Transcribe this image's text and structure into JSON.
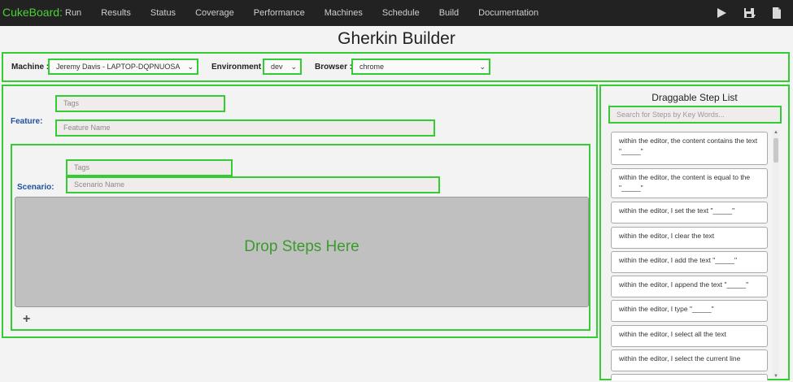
{
  "navbar": {
    "brand": "CukeBoard:",
    "items": [
      "Run",
      "Results",
      "Status",
      "Coverage",
      "Performance",
      "Machines",
      "Schedule",
      "Build",
      "Documentation"
    ],
    "icons": [
      "play-icon",
      "save-icon",
      "file-icon"
    ]
  },
  "page": {
    "title": "Gherkin Builder"
  },
  "config": {
    "machine_label": "Machine :",
    "machine_value": "Jeremy Davis - LAPTOP-DQPNUOSA",
    "environment_label": "Environment :",
    "environment_value": "dev",
    "browser_label": "Browser :",
    "browser_value": "chrome"
  },
  "feature": {
    "label": "Feature:",
    "tags_placeholder": "Tags",
    "name_placeholder": "Feature Name"
  },
  "scenario": {
    "label": "Scenario:",
    "tags_placeholder": "Tags",
    "name_placeholder": "Scenario Name",
    "drop_text": "Drop Steps Here",
    "add_label": "+"
  },
  "step_list": {
    "title": "Draggable Step List",
    "search_placeholder": "Search for Steps by Key Words...",
    "steps": [
      "within the editor, the content contains the text \"_____\"",
      "within the editor, the content is equal to the \"_____\"",
      "within the editor, I set the text \"_____\"",
      "within the editor, I clear the text",
      "within the editor, I add the text \"_____\"",
      "within the editor, I append the text \"_____\"",
      "within the editor, I type \"_____\"",
      "within the editor, I select all the text",
      "within the editor, I select the current line"
    ]
  },
  "colors": {
    "accent": "#33cc33",
    "navbar_bg": "#222222",
    "brand": "#4cd137",
    "drop_text": "#3a9b2b"
  }
}
